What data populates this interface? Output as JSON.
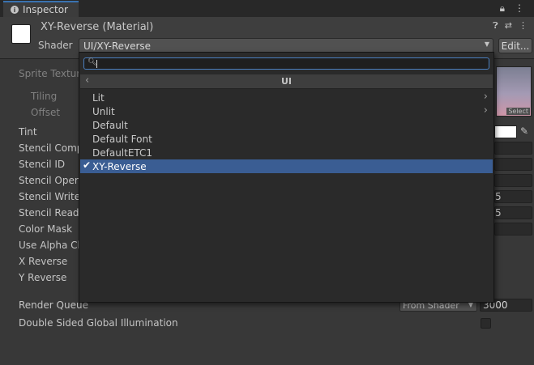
{
  "tab": {
    "label": "Inspector"
  },
  "header": {
    "material_name": "XY-Reverse (Material)",
    "shader_label": "Shader",
    "shader_value": "UI/XY-Reverse",
    "edit_label": "Edit..."
  },
  "properties": {
    "sprite_texture": "Sprite Texture",
    "tiling": "Tiling",
    "offset": "Offset",
    "texture_select": "Select",
    "tint": "Tint",
    "stencil_comp": "Stencil Comp",
    "stencil_id": "Stencil ID",
    "stencil_op": "Stencil Opera",
    "stencil_write": "Stencil Write",
    "stencil_read": "Stencil Read",
    "color_mask": "Color Mask",
    "use_alpha_clip": "Use Alpha Cli",
    "x_reverse": "X Reverse",
    "y_reverse": "Y Reverse",
    "stencil_write_val": "5",
    "stencil_read_val": "5"
  },
  "render_queue": {
    "label": "Render Queue",
    "mode": "From Shader",
    "value": "3000"
  },
  "double_sided_gi": {
    "label": "Double Sided Global Illumination",
    "checked": false
  },
  "popup": {
    "search_value": "",
    "breadcrumb": "UI",
    "items": [
      {
        "label": "Lit",
        "has_submenu": true
      },
      {
        "label": "Unlit",
        "has_submenu": true
      },
      {
        "label": "Default"
      },
      {
        "label": "Default Font"
      },
      {
        "label": "DefaultETC1"
      },
      {
        "label": "XY-Reverse",
        "selected": true
      }
    ]
  },
  "icons": {
    "tab_icon": "info-icon",
    "lock": "lock-icon",
    "menu": "kebab-menu-icon",
    "help": "help-icon",
    "preset": "sliders-icon",
    "more": "more-icon",
    "search": "search-icon",
    "back": "chevron-left-icon",
    "submenu": "chevron-right-icon",
    "check": "checkmark-icon",
    "picker": "eyedropper-icon"
  }
}
